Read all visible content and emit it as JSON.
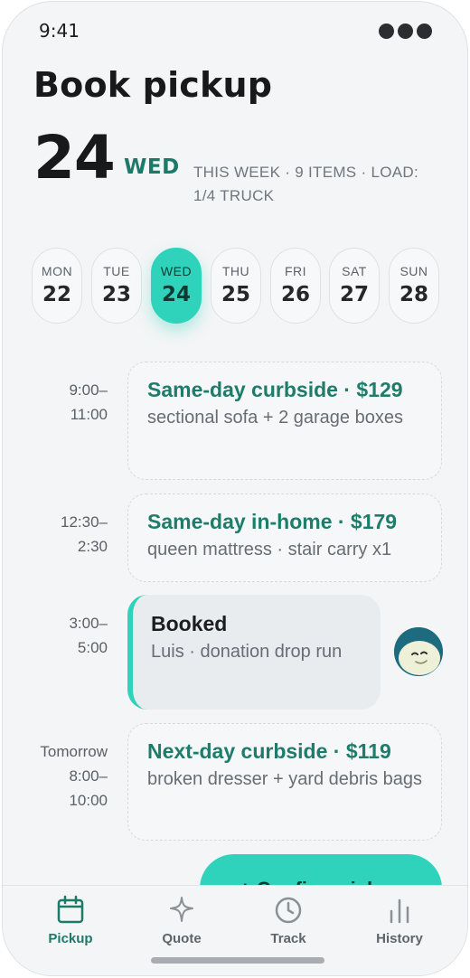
{
  "status_bar": {
    "time": "9:41"
  },
  "header": {
    "title": "Book pickup",
    "day_number": "24",
    "weekday": "WED",
    "week_info": "THIS WEEK · 9 ITEMS · LOAD: 1/4 TRUCK"
  },
  "days": [
    {
      "name": "MON",
      "num": "22",
      "selected": false
    },
    {
      "name": "TUE",
      "num": "23",
      "selected": false
    },
    {
      "name": "WED",
      "num": "24",
      "selected": true
    },
    {
      "name": "THU",
      "num": "25",
      "selected": false
    },
    {
      "name": "FRI",
      "num": "26",
      "selected": false
    },
    {
      "name": "SAT",
      "num": "27",
      "selected": false
    },
    {
      "name": "SUN",
      "num": "28",
      "selected": false
    }
  ],
  "slots": [
    {
      "time_start": "9:00–",
      "time_end": "11:00",
      "title": "Same-day curbside · $129",
      "desc": "sectional sofa + 2 garage boxes"
    },
    {
      "time_start": "12:30–",
      "time_end": "2:30",
      "title": "Same-day in-home · $179",
      "desc": "queen mattress · stair carry x1"
    },
    {
      "time_start": "3:00–",
      "time_end": "5:00",
      "title": "Booked",
      "desc": "Luis · donation drop run"
    },
    {
      "time_prefix": "Tomorrow",
      "time_start": "8:00–",
      "time_end": "10:00",
      "title": "Next-day curbside · $119",
      "desc": "broken dresser + yard debris bags"
    }
  ],
  "confirm_button": {
    "label": "+ Confirm pickup"
  },
  "tabs": [
    {
      "label": "Pickup",
      "icon": "calendar-icon",
      "active": true
    },
    {
      "label": "Quote",
      "icon": "sparkle-icon",
      "active": false
    },
    {
      "label": "Track",
      "icon": "clock-icon",
      "active": false
    },
    {
      "label": "History",
      "icon": "bar-chart-icon",
      "active": false
    }
  ],
  "colors": {
    "accent": "#2fd3bb",
    "accent_text": "#1b7a68",
    "background": "#f3f5f6"
  }
}
